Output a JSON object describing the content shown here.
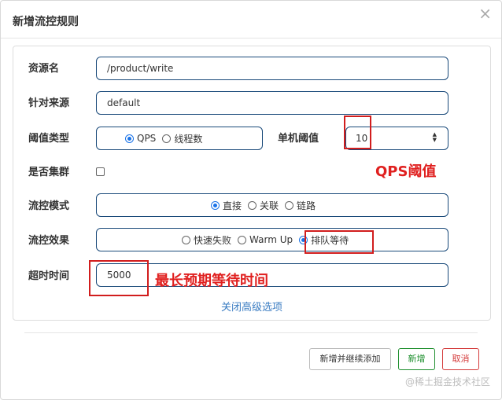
{
  "dialog": {
    "title": "新增流控规则",
    "close_symbol": "×"
  },
  "form": {
    "resource_name": {
      "label": "资源名",
      "value": "/product/write"
    },
    "limit_app": {
      "label": "针对来源",
      "value": "default"
    },
    "grade": {
      "label": "阈值类型",
      "options": [
        "QPS",
        "线程数"
      ],
      "selected": "QPS"
    },
    "count": {
      "label": "单机阈值",
      "value": "10"
    },
    "cluster": {
      "label": "是否集群",
      "checked": false
    },
    "strategy": {
      "label": "流控模式",
      "options": [
        "直接",
        "关联",
        "链路"
      ],
      "selected": "直接"
    },
    "control_behavior": {
      "label": "流控效果",
      "options": [
        "快速失败",
        "Warm Up",
        "排队等待"
      ],
      "selected": "排队等待"
    },
    "timeout": {
      "label": "超时时间",
      "value": "5000"
    }
  },
  "annotations": {
    "qps_threshold": "QPS阈值",
    "max_wait": "最长预期等待时间"
  },
  "advanced_link": "关闭高级选项",
  "buttons": {
    "add_continue": "新增并继续添加",
    "add": "新增",
    "cancel": "取消"
  },
  "watermark": "@稀土掘金技术社区",
  "colors": {
    "input_border": "#1a4a7a",
    "radio_checked": "#1a73e8",
    "annotation_red": "#e0201f",
    "link_blue": "#3a7cc2",
    "success_green": "#1e8f2e",
    "danger_red": "#d43a3a"
  }
}
